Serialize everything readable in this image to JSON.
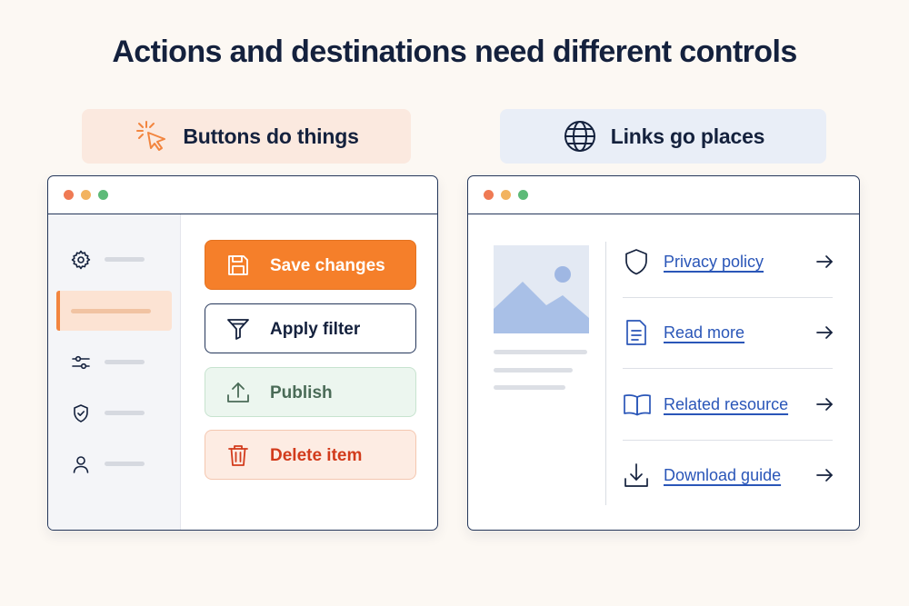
{
  "title": "Actions and destinations need different controls",
  "left_panel": {
    "heading": "Buttons do things",
    "heading_icon": "cursor-click-icon",
    "sidebar": [
      {
        "icon": "gear-icon",
        "active": false
      },
      {
        "icon": "",
        "active": true
      },
      {
        "icon": "sliders-icon",
        "active": false
      },
      {
        "icon": "shield-check-icon",
        "active": false
      },
      {
        "icon": "user-icon",
        "active": false
      }
    ],
    "buttons": [
      {
        "label": "Save changes",
        "icon": "save-icon",
        "style": "primary"
      },
      {
        "label": "Apply filter",
        "icon": "filter-icon",
        "style": "secondary"
      },
      {
        "label": "Publish",
        "icon": "upload-icon",
        "style": "success"
      },
      {
        "label": "Delete item",
        "icon": "trash-icon",
        "style": "danger"
      }
    ]
  },
  "right_panel": {
    "heading": "Links go places",
    "heading_icon": "globe-icon",
    "links": [
      {
        "label": "Privacy policy",
        "icon": "shield-icon"
      },
      {
        "label": "Read more",
        "icon": "document-icon"
      },
      {
        "label": "Related resource",
        "icon": "book-icon"
      },
      {
        "label": "Download guide",
        "icon": "download-icon"
      }
    ]
  },
  "colors": {
    "background": "#fcf8f3",
    "primary_orange": "#f57f2a",
    "link_blue": "#2a56b8",
    "danger_red": "#d23b1c",
    "success_green_bg": "#ecf6ef",
    "navy": "#14213d"
  }
}
